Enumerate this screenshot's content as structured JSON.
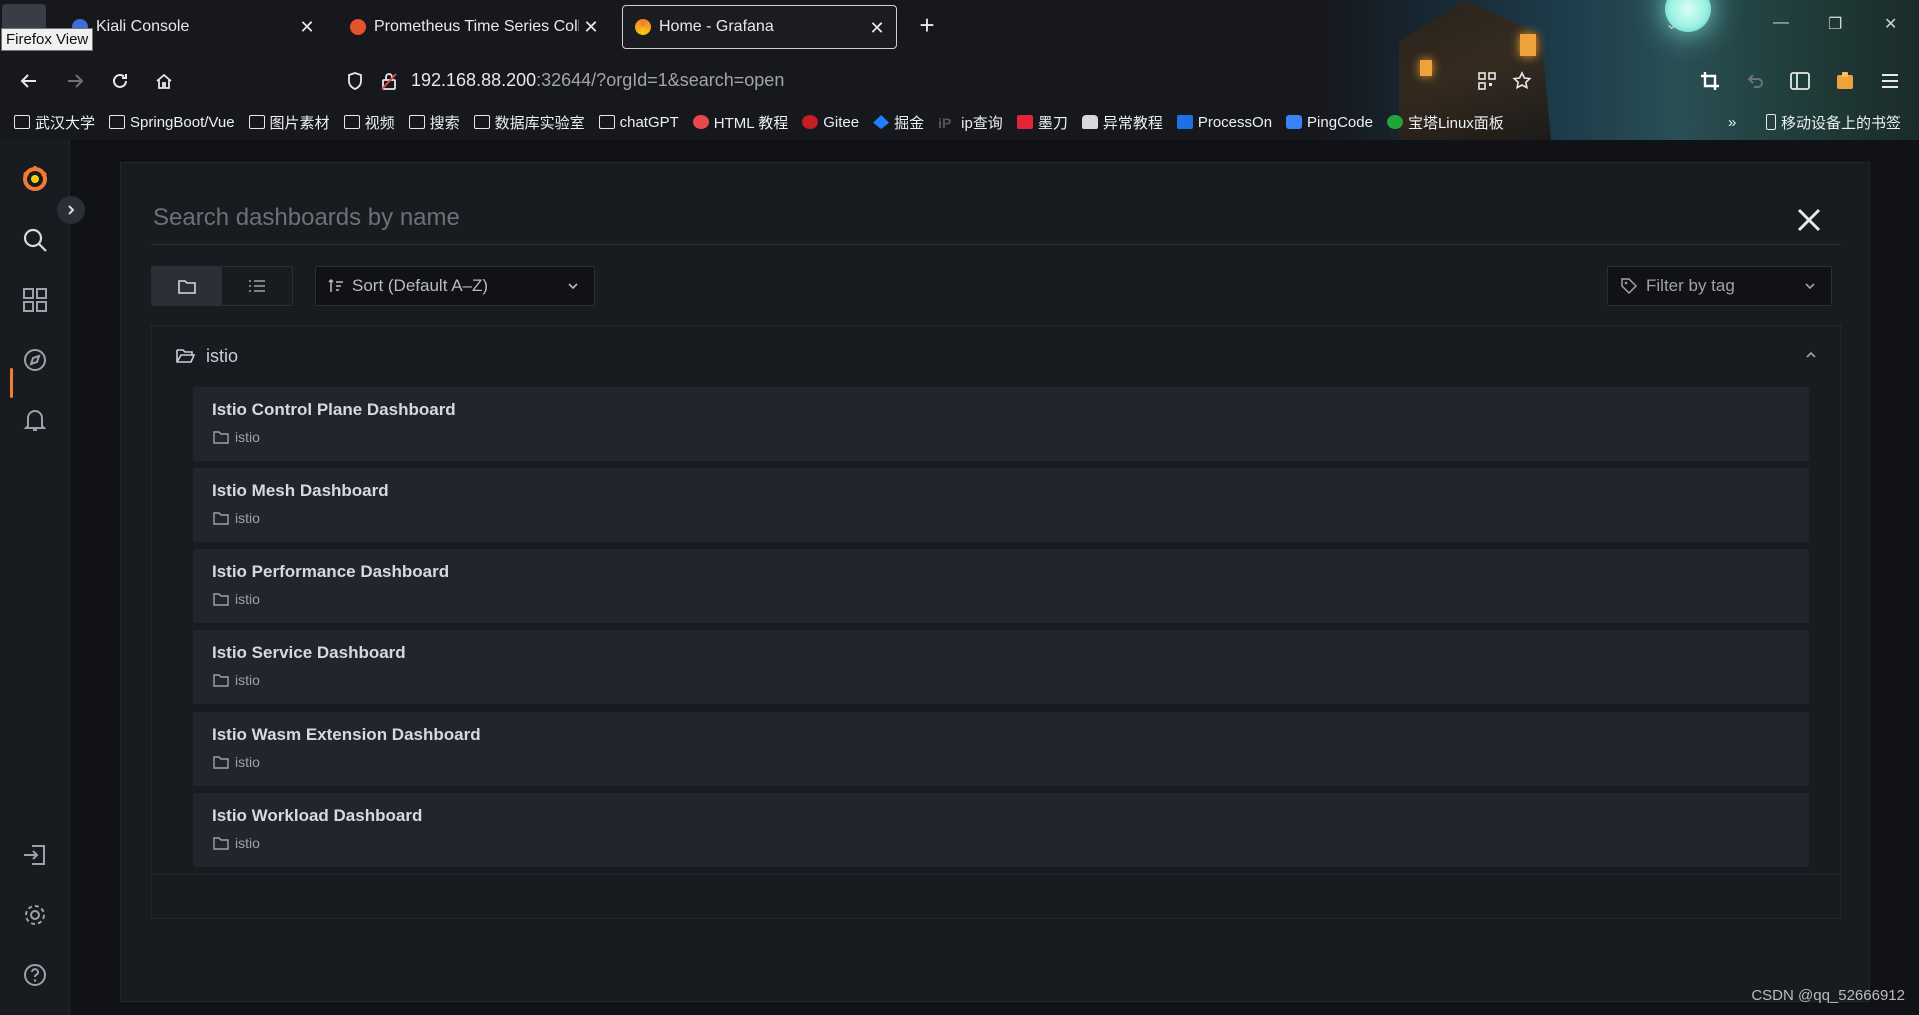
{
  "browser": {
    "tooltip": "Firefox View",
    "tabs": [
      {
        "title": "Kiali Console",
        "active": false
      },
      {
        "title": "Prometheus Time Series Coll",
        "active": false
      },
      {
        "title": "Home - Grafana",
        "active": true
      }
    ],
    "url_host": "192.168.88.200",
    "url_rest": ":32644/?orgId=1&search=open",
    "bookmarks": [
      {
        "label": "武汉大学",
        "icon": "folder-icon"
      },
      {
        "label": "SpringBoot/Vue",
        "icon": "folder-icon"
      },
      {
        "label": "图片素材",
        "icon": "folder-icon"
      },
      {
        "label": "视频",
        "icon": "folder-icon"
      },
      {
        "label": "搜索",
        "icon": "folder-icon"
      },
      {
        "label": "数据库实验室",
        "icon": "folder-icon"
      },
      {
        "label": "chatGPT",
        "icon": "folder-icon"
      },
      {
        "label": "HTML 教程",
        "icon": "html-logo-icon"
      },
      {
        "label": "Gitee",
        "icon": "gitee-logo-icon"
      },
      {
        "label": "掘金",
        "icon": "juejin-logo-icon"
      },
      {
        "label": "ip查询",
        "icon": "ip-logo-icon"
      },
      {
        "label": "墨刀",
        "icon": "modao-logo-icon"
      },
      {
        "label": "异常教程",
        "icon": "hand-icon"
      },
      {
        "label": "ProcessOn",
        "icon": "processon-logo-icon"
      },
      {
        "label": "PingCode",
        "icon": "pingcode-logo-icon"
      },
      {
        "label": "宝塔Linux面板",
        "icon": "baota-logo-icon"
      }
    ],
    "bookmarks_mobile": "移动设备上的书签"
  },
  "grafana": {
    "search_placeholder": "Search dashboards by name",
    "sort_label": "Sort (Default A–Z)",
    "tag_filter_label": "Filter by tag",
    "folder": {
      "name": "istio",
      "dashboards": [
        {
          "title": "Istio Control Plane Dashboard",
          "folder": "istio"
        },
        {
          "title": "Istio Mesh Dashboard",
          "folder": "istio"
        },
        {
          "title": "Istio Performance Dashboard",
          "folder": "istio"
        },
        {
          "title": "Istio Service Dashboard",
          "folder": "istio"
        },
        {
          "title": "Istio Wasm Extension Dashboard",
          "folder": "istio"
        },
        {
          "title": "Istio Workload Dashboard",
          "folder": "istio"
        }
      ]
    }
  },
  "watermark": "CSDN @qq_52666912",
  "colors": {
    "accent": "#f37a34",
    "panel": "#181b1f",
    "item": "#22252b",
    "text": "#ccccdc"
  }
}
